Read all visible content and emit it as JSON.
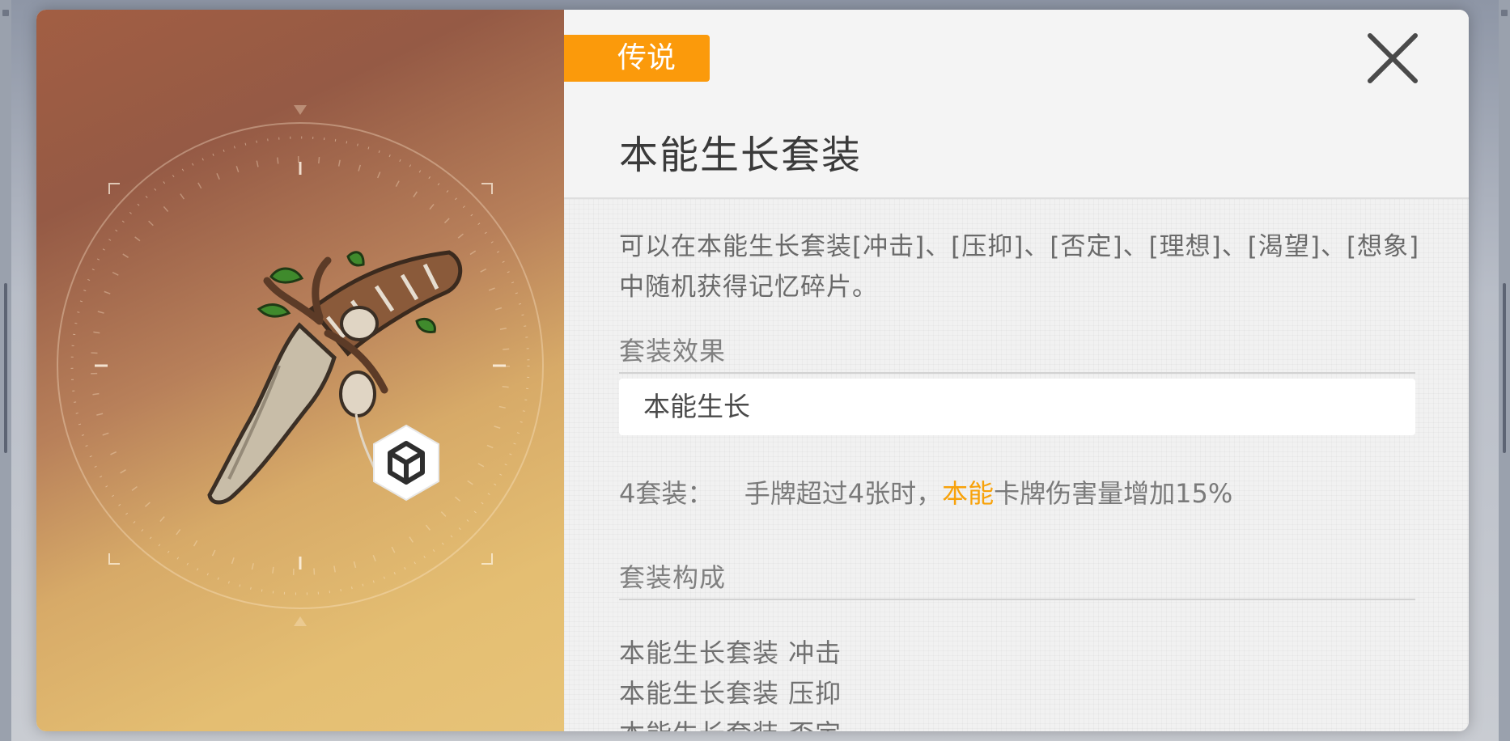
{
  "dialog": {
    "rarity_label": "传说",
    "title": "本能生长套装",
    "description": "可以在本能生长套装[冲击]、[压抑]、[否定]、[理想]、[渴望]、[想象]中随机获得记忆碎片。",
    "set_effect": {
      "heading": "套装效果",
      "effect_name": "本能生长",
      "tier_label": "4套装：",
      "text_before": "手牌超过4张时，",
      "highlight": "本能",
      "text_after": "卡牌伤害量增加15%"
    },
    "set_composition": {
      "heading": "套装构成",
      "members": [
        "本能生长套装 冲击",
        "本能生长套装 压抑",
        "本能生长套装 否定"
      ]
    }
  },
  "colors": {
    "rarity_badge": "#fb9a0b",
    "highlight": "#f8a20a",
    "art_gradient_top": "#a25e43",
    "art_gradient_bottom": "#e7c378"
  },
  "icons": {
    "close": "close-x-icon",
    "item": "root-dagger-artwork",
    "rarity": "cube-hexagon-icon"
  }
}
